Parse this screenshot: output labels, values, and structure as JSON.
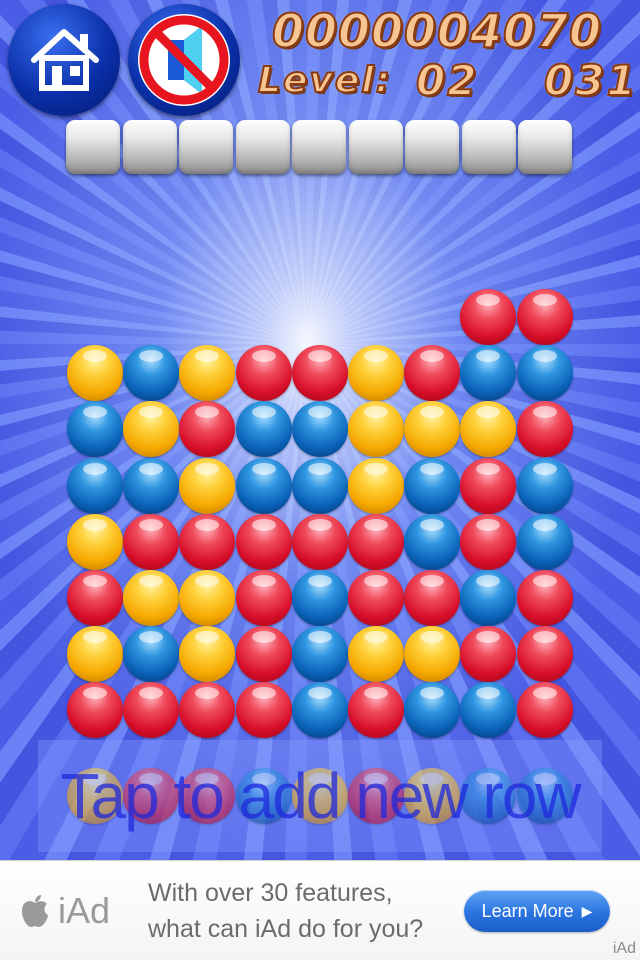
{
  "hud": {
    "score": "0000004070",
    "level_label": "Level:",
    "level_value": "02",
    "moves_value": "031",
    "home_button_icon": "home-icon",
    "sound_button_icon": "sound-muted-icon"
  },
  "progress": {
    "total_cells": 9,
    "filled_cells": 0
  },
  "board": {
    "columns": 9,
    "colors": {
      "red": "#d8102a",
      "blue": "#0b62b8",
      "yellow": "#f5a800"
    },
    "grid": [
      [
        null,
        null,
        null,
        null,
        null,
        null,
        null,
        "red",
        "red"
      ],
      [
        "yellow",
        "blue",
        "yellow",
        "red",
        "red",
        "yellow",
        "red",
        "blue",
        "blue"
      ],
      [
        "blue",
        "yellow",
        "red",
        "blue",
        "blue",
        "yellow",
        "yellow",
        "yellow",
        "red"
      ],
      [
        "blue",
        "blue",
        "yellow",
        "blue",
        "blue",
        "yellow",
        "blue",
        "red",
        "blue"
      ],
      [
        "yellow",
        "red",
        "red",
        "red",
        "red",
        "red",
        "blue",
        "red",
        "blue"
      ],
      [
        "red",
        "yellow",
        "yellow",
        "red",
        "blue",
        "red",
        "red",
        "blue",
        "red"
      ],
      [
        "yellow",
        "blue",
        "yellow",
        "red",
        "blue",
        "yellow",
        "yellow",
        "red",
        "red"
      ],
      [
        "red",
        "red",
        "red",
        "red",
        "blue",
        "red",
        "blue",
        "blue",
        "red"
      ]
    ],
    "next_row": [
      "yellow",
      "red",
      "red",
      "blue",
      "yellow",
      "red",
      "yellow",
      "blue",
      "blue"
    ]
  },
  "new_row": {
    "label": "Tap to add new row"
  },
  "ad": {
    "logo_text": "iAd",
    "message_line1": "With over 30 features,",
    "message_line2": "what can iAd do for you?",
    "button_label": "Learn More",
    "corner_label": "iAd"
  }
}
